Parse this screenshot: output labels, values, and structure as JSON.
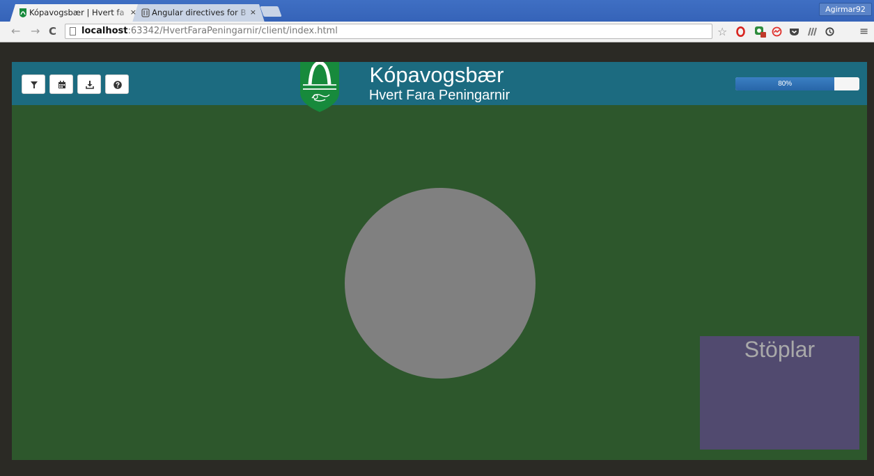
{
  "browser": {
    "tabs": [
      {
        "label": "Kópavogsbær | Hvert fa",
        "active": true
      },
      {
        "label": "Angular directives for B",
        "active": false
      }
    ],
    "close_glyph": "×",
    "profile_name": "Agirmar92",
    "url_host": "localhost",
    "url_rest": ":63342/HvertFaraPeningarnir/client/index.html",
    "icons": [
      "back-arrow-icon",
      "forward-arrow-icon",
      "reload-icon",
      "page-icon",
      "bookmark-star-icon",
      "opera-icon",
      "extension-badge-icon",
      "speed-icon",
      "pocket-icon",
      "library-icon",
      "sync-icon",
      "menu-icon"
    ]
  },
  "app": {
    "title": "Kópavogsbær",
    "subtitle": "Hvert Fara Peningarnir",
    "toolbar_buttons": [
      {
        "icon": "filter-icon"
      },
      {
        "icon": "calendar-icon"
      },
      {
        "icon": "download-icon"
      },
      {
        "icon": "help-icon"
      }
    ],
    "progress": {
      "value": 0.8,
      "label": "80%"
    },
    "panel_title": "Stöplar",
    "colors": {
      "navbar": "#1c6b80",
      "background": "#2d572c",
      "circle": "#808080",
      "panel": "#514a6f",
      "progress_bar": "#2f72b8"
    }
  }
}
